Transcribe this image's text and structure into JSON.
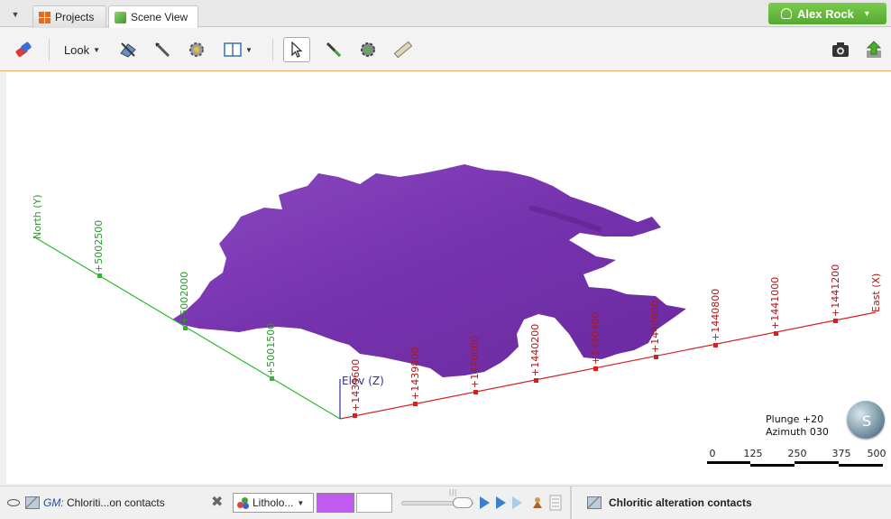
{
  "tabs": {
    "menu_icon": "dropdown-triangle-icon",
    "items": [
      {
        "label": "Projects",
        "icon": "projects-grid-icon",
        "active": false
      },
      {
        "label": "Scene View",
        "icon": "green-cube-icon",
        "active": true
      }
    ]
  },
  "user": {
    "name": "Alex Rock",
    "color": "#66b93f"
  },
  "toolbar": {
    "look_label": "Look",
    "icons": [
      "eraser-icon",
      "look-icon",
      "slice-tool-icon",
      "pencil-knife-icon",
      "snap-gear-icon",
      "panel-layout-icon",
      "select-arrow-icon",
      "draw-line-icon",
      "polyline-gear-icon",
      "ruler-icon",
      "camera-icon",
      "share-upload-icon"
    ]
  },
  "scene": {
    "surface_color": "#7a3ab0",
    "axes": {
      "north": {
        "label": "North (Y)",
        "color": "#2bbb2b",
        "ticks": [
          "+5002500",
          "+5002000",
          "+5001500"
        ]
      },
      "east": {
        "label": "East (X)",
        "color": "#d62020",
        "ticks": [
          "+1439600",
          "+1439800",
          "+1440000",
          "+1440200",
          "+1440400",
          "+1440600",
          "+1440800",
          "+1441000",
          "+1441200"
        ]
      },
      "elev": {
        "label": "Elev (Z)",
        "color": "#3030a0"
      }
    },
    "orientation": {
      "plunge": "Plunge +20",
      "azimuth": "Azimuth 030"
    },
    "compass_letter": "S",
    "scale_ticks": [
      "0",
      "125",
      "250",
      "375",
      "500"
    ]
  },
  "bottom": {
    "gm_prefix": "GM:",
    "gm_name": "Chloriti...on contacts",
    "color_mode": "Litholo...",
    "swatch_color": "#c05af0",
    "right_title": "Chloritic alteration contacts"
  }
}
